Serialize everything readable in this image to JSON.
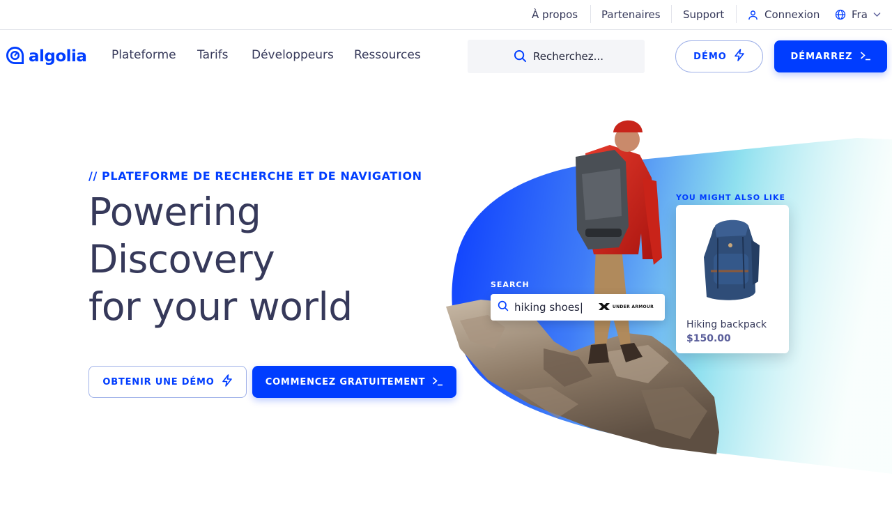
{
  "colors": {
    "brand": "#003dff",
    "text": "#36395a",
    "search_bg": "#f4f5f8",
    "outline": "#9fb1e8"
  },
  "util_nav": {
    "about": "À propos",
    "partners": "Partenaires",
    "support": "Support",
    "login": "Connexion",
    "language": "Fra"
  },
  "nav": {
    "logo": "algolia",
    "links": [
      "Plateforme",
      "Tarifs",
      "Développeurs",
      "Ressources"
    ],
    "search_placeholder": "Recherchez...",
    "demo_button": "DÉMO",
    "start_button": "DÉMARREZ"
  },
  "hero": {
    "eyebrow": "// PLATEFORME DE RECHERCHE ET DE NAVIGATION",
    "headline": [
      "Powering",
      "Discovery",
      "for your world"
    ],
    "cta_demo": "OBTENIR UNE DÉMO",
    "cta_start": "COMMENCEZ GRATUITEMENT"
  },
  "illustration": {
    "search_label": "SEARCH",
    "search_query": "hiking shoes|",
    "brand_logo": "UNDER ARMOUR",
    "recommend_label": "YOU MIGHT ALSO LIKE",
    "product_name": "Hiking backpack",
    "product_price": "$150.00"
  },
  "icons": [
    "user-icon",
    "globe-icon",
    "chevron-down-icon",
    "search-icon",
    "lightning-icon",
    "terminal-icon",
    "algolia-logo-icon"
  ]
}
